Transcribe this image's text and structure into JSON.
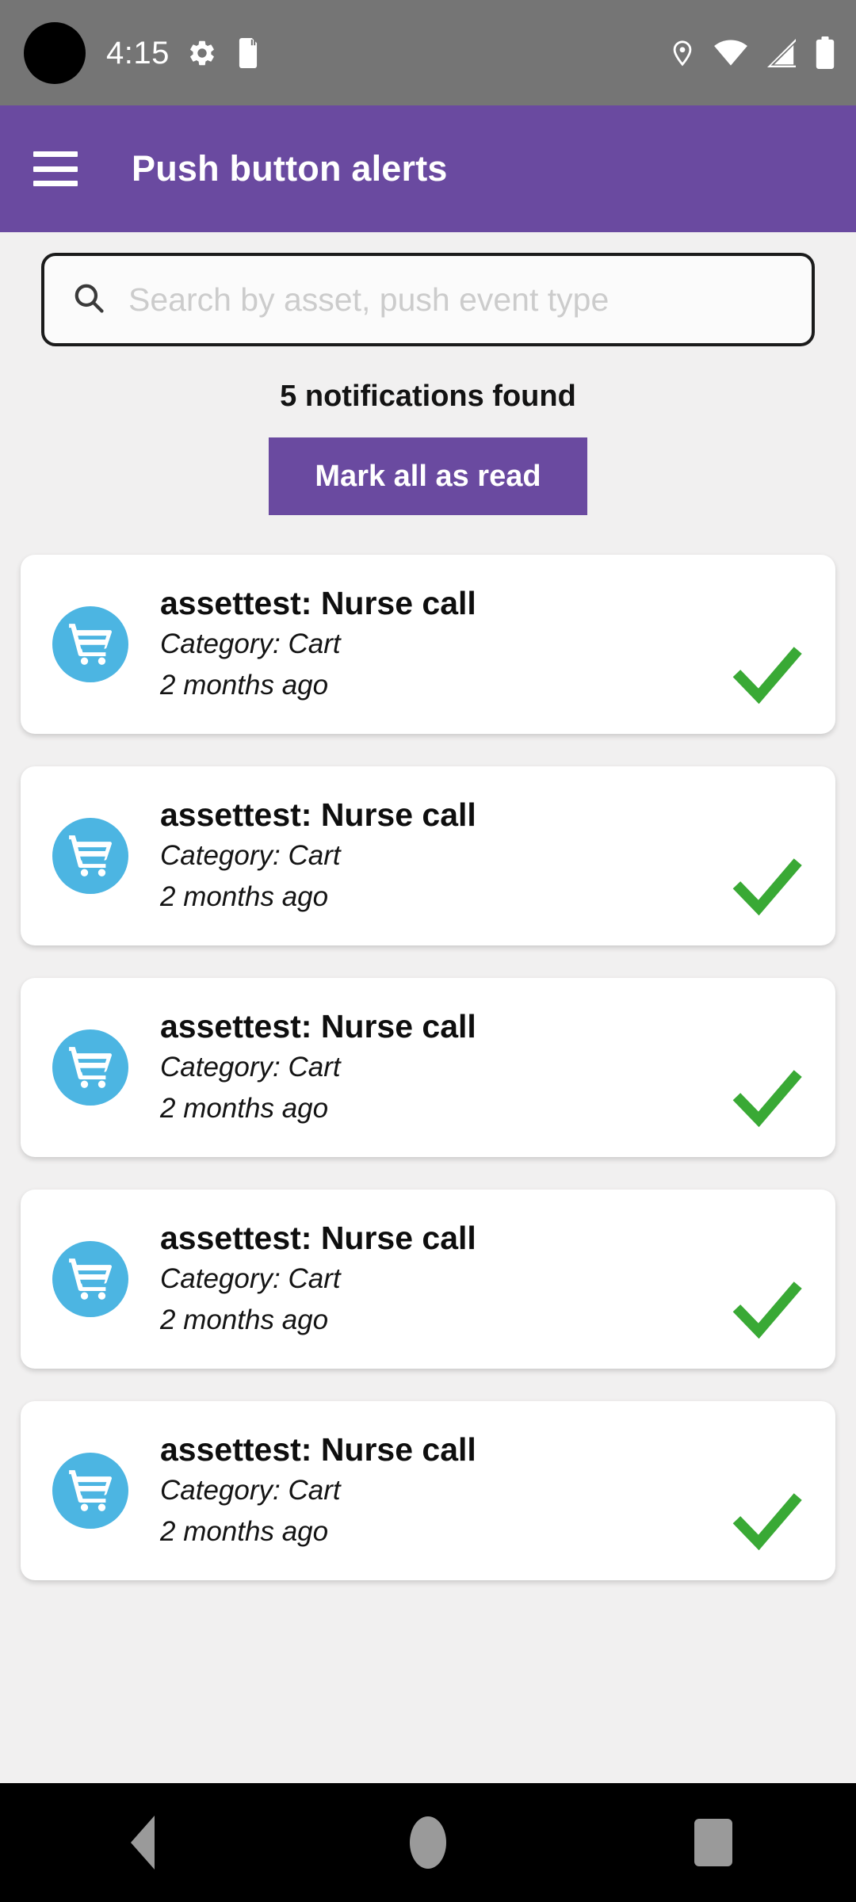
{
  "status_bar": {
    "time": "4:15",
    "icons_left": [
      "settings-gear-icon",
      "sd-card-icon"
    ],
    "icons_right": [
      "location-pin-icon",
      "wifi-icon",
      "cellular-signal-icon",
      "battery-icon"
    ],
    "background_color": "#757575"
  },
  "app_bar": {
    "menu_icon": "hamburger-menu-icon",
    "title": "Push button alerts",
    "background_color": "#6a4aa0"
  },
  "search": {
    "placeholder": "Search by asset, push event type",
    "value": "",
    "icon": "search-icon"
  },
  "summary": {
    "count_text": "5 notifications found",
    "mark_all_label": "Mark all as read"
  },
  "notifications": [
    {
      "title": "assettest: Nurse call",
      "category": "Category: Cart",
      "time": "2 months ago",
      "icon": "shopping-cart-icon",
      "status_icon": "green-check-icon"
    },
    {
      "title": "assettest: Nurse call",
      "category": "Category: Cart",
      "time": "2 months ago",
      "icon": "shopping-cart-icon",
      "status_icon": "green-check-icon"
    },
    {
      "title": "assettest: Nurse call",
      "category": "Category: Cart",
      "time": "2 months ago",
      "icon": "shopping-cart-icon",
      "status_icon": "green-check-icon"
    },
    {
      "title": "assettest: Nurse call",
      "category": "Category: Cart",
      "time": "2 months ago",
      "icon": "shopping-cart-icon",
      "status_icon": "green-check-icon"
    },
    {
      "title": "assettest: Nurse call",
      "category": "Category: Cart",
      "time": "2 months ago",
      "icon": "shopping-cart-icon",
      "status_icon": "green-check-icon"
    }
  ],
  "nav_bar": {
    "back": "back-nav-icon",
    "home": "home-nav-icon",
    "recents": "recents-nav-icon"
  },
  "colors": {
    "accent_purple": "#6a4aa0",
    "avatar_blue": "#4cb5e2",
    "check_green": "#39a935",
    "page_background": "#f1f0f0"
  }
}
